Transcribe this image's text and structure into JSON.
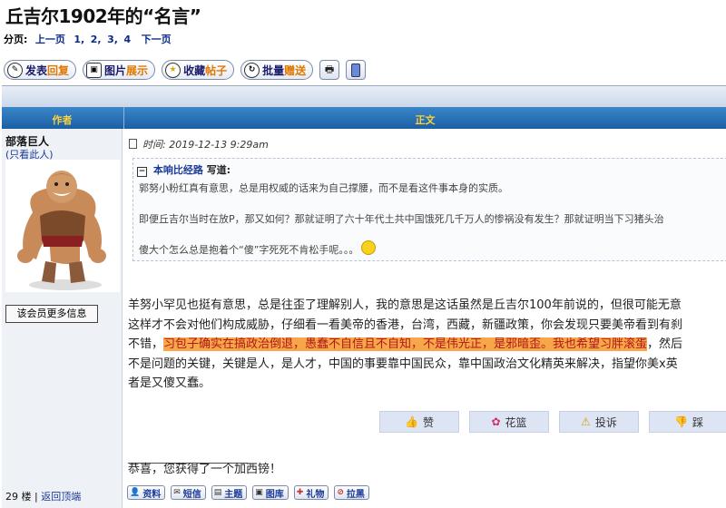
{
  "page": {
    "title": "丘吉尔1902年的“名言”"
  },
  "pager": {
    "label": "分页:",
    "prev": "上一页",
    "pages": [
      "1,",
      "2,",
      "3,",
      "4"
    ],
    "next": "下一页"
  },
  "actions": [
    {
      "pre": "发表",
      "hl": "回复",
      "icon": "compose-icon"
    },
    {
      "pre": "图片",
      "hl": "展示",
      "icon": "picture-icon"
    },
    {
      "pre": "收藏",
      "hl": "帖子",
      "icon": "star-icon"
    },
    {
      "pre": "批量",
      "hl": "赠送",
      "icon": "refresh-icon"
    }
  ],
  "table": {
    "col_author": "作者",
    "col_body": "正文"
  },
  "post": {
    "author": "部落巨人",
    "only_this": "(只看此人)",
    "more_info": "该会员更多信息",
    "time": "时间: 2019-12-13 9:29am",
    "quote": {
      "who": "本响比经路",
      "said": "写道:",
      "lines": [
        "郭努小粉红真有意思，总是用权威的话来为自己撑腰，而不是看这件事本身的实质。",
        "即便丘吉尔当时在放P，那又如何？那就证明了六十年代土共中国饿死几千万人的惨祸没有发生？那就证明当下习猪头治",
        "傻大个怎么总是抱着个“傻”字死死不肯松手呢。。。"
      ]
    },
    "body": {
      "l1": "羊努小罕见也挺有意思，总是往歪了理解别人，我的意思是这话虽然是丘吉尔100年前说的，但很可能无意",
      "l2": "这样才不会对他们构成威胁，仔细看一看美帝的香港，台湾，西藏，新疆政策，你会发现只要美帝看到有刹",
      "l3a": "不错，",
      "l3hl": "习包子确实在搞政治倒退，愚蠢不自信且不自知，不是伟光正，是邪暗歪。我也希望习胖滚蛋",
      "l3b": "，然后",
      "l4": "不是问题的关键，关键是人，是人才，中国的事要靠中国民众，靠中国政治文化精英来解决，指望你美x英",
      "l5": "者是又傻又蠢。"
    },
    "votes": [
      {
        "label": "赞",
        "icon": "👍",
        "name": "like-button"
      },
      {
        "label": "花篮",
        "icon": "✿",
        "name": "flower-basket-button"
      },
      {
        "label": "投诉",
        "icon": "⚠",
        "name": "report-button"
      },
      {
        "label": "踩",
        "icon": "👎",
        "name": "dislike-button"
      }
    ],
    "divider": "______________________",
    "medal_text": "恭喜，您获得了一个加西镑！",
    "floor": "29 楼",
    "back_top": "返回顶端",
    "bottom_buttons": [
      {
        "label": "资料",
        "icon": "person-icon"
      },
      {
        "label": "短信",
        "icon": "message-icon"
      },
      {
        "label": "主题",
        "icon": "topic-icon"
      },
      {
        "label": "图库",
        "icon": "gallery-icon"
      },
      {
        "label": "礼物",
        "icon": "gift-icon"
      },
      {
        "label": "拉黑",
        "icon": "block-icon"
      }
    ]
  }
}
